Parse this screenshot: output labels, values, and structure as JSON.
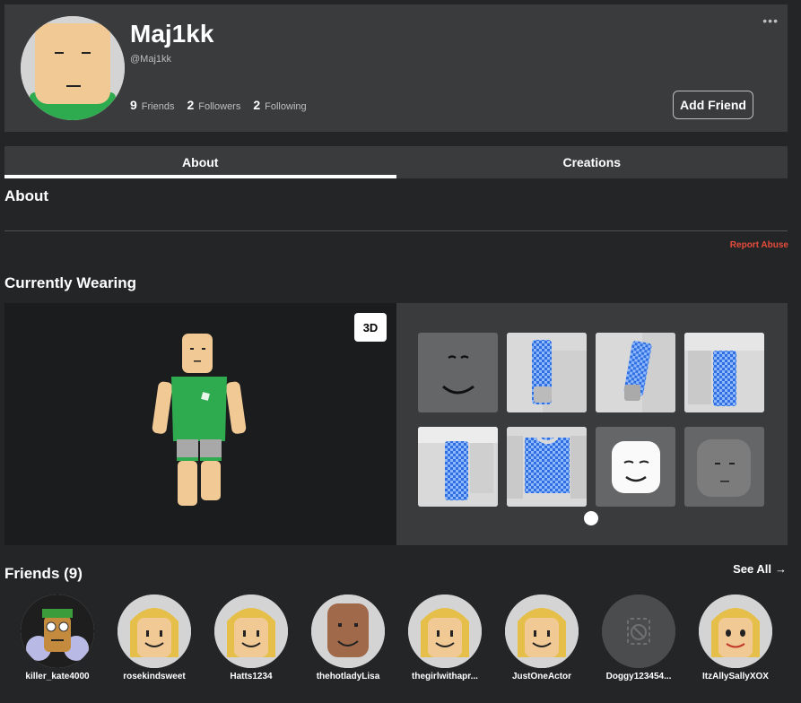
{
  "profile": {
    "display_name": "Maj1kk",
    "username": "@Maj1kk",
    "friends_count": "9",
    "friends_label": "Friends",
    "followers_count": "2",
    "followers_label": "Followers",
    "following_count": "2",
    "following_label": "Following",
    "add_friend_label": "Add Friend",
    "more_icon": "•••"
  },
  "tabs": [
    {
      "label": "About",
      "active": true
    },
    {
      "label": "Creations",
      "active": false
    }
  ],
  "about": {
    "title": "About",
    "report_label": "Report Abuse"
  },
  "wearing": {
    "title": "Currently Wearing",
    "view_3d_label": "3D"
  },
  "friends_section": {
    "title": "Friends (9)",
    "see_all_label": "See All",
    "friends": [
      {
        "name": "killer_kate4000"
      },
      {
        "name": "rosekindsweet"
      },
      {
        "name": "Hatts1234"
      },
      {
        "name": "thehotladyLisa"
      },
      {
        "name": "thegirlwithapr..."
      },
      {
        "name": "JustOneActor"
      },
      {
        "name": "Doggy123454..."
      },
      {
        "name": "ItzAllySallyXOX"
      }
    ]
  },
  "colors": {
    "background": "#232527",
    "card": "#393b3d",
    "report": "#e74c3c",
    "skin": "#f1c995",
    "shirt": "#2eaa4f"
  }
}
